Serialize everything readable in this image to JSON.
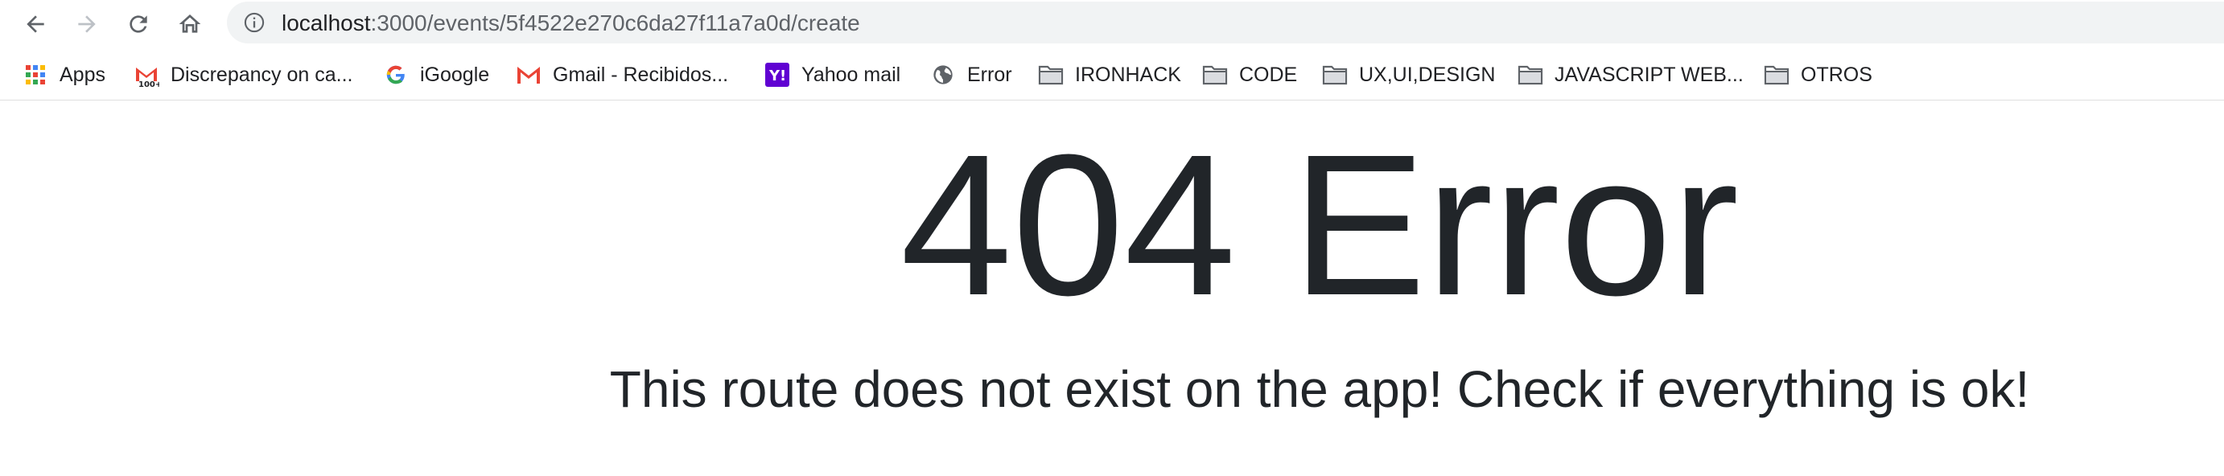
{
  "browser": {
    "url_host": "localhost",
    "url_rest": ":3000/events/5f4522e270c6da27f11a7a0d/create"
  },
  "bookmarks": [
    {
      "label": "Apps",
      "icon": "apps-grid-icon"
    },
    {
      "label": "Discrepancy on ca...",
      "icon": "gmail-100-icon"
    },
    {
      "label": "iGoogle",
      "icon": "google-icon"
    },
    {
      "label": "Gmail - Recibidos...",
      "icon": "gmail-icon"
    },
    {
      "label": "Yahoo mail",
      "icon": "yahoo-icon"
    },
    {
      "label": "Error",
      "icon": "globe-icon"
    },
    {
      "label": "IRONHACK",
      "icon": "folder-icon"
    },
    {
      "label": "CODE",
      "icon": "folder-icon"
    },
    {
      "label": "UX,UI,DESIGN",
      "icon": "folder-icon"
    },
    {
      "label": "JAVASCRIPT WEB...",
      "icon": "folder-icon"
    },
    {
      "label": "OTROS",
      "icon": "folder-icon"
    }
  ],
  "page": {
    "title": "404 Error",
    "message": "This route does not exist on the app! Check if everything is ok!"
  },
  "colors": {
    "text": "#212529",
    "omnibox_bg": "#f1f3f4",
    "folder_gray": "#5f6368",
    "yahoo_purple": "#6001d2",
    "gmail_red": "#ea4335"
  }
}
